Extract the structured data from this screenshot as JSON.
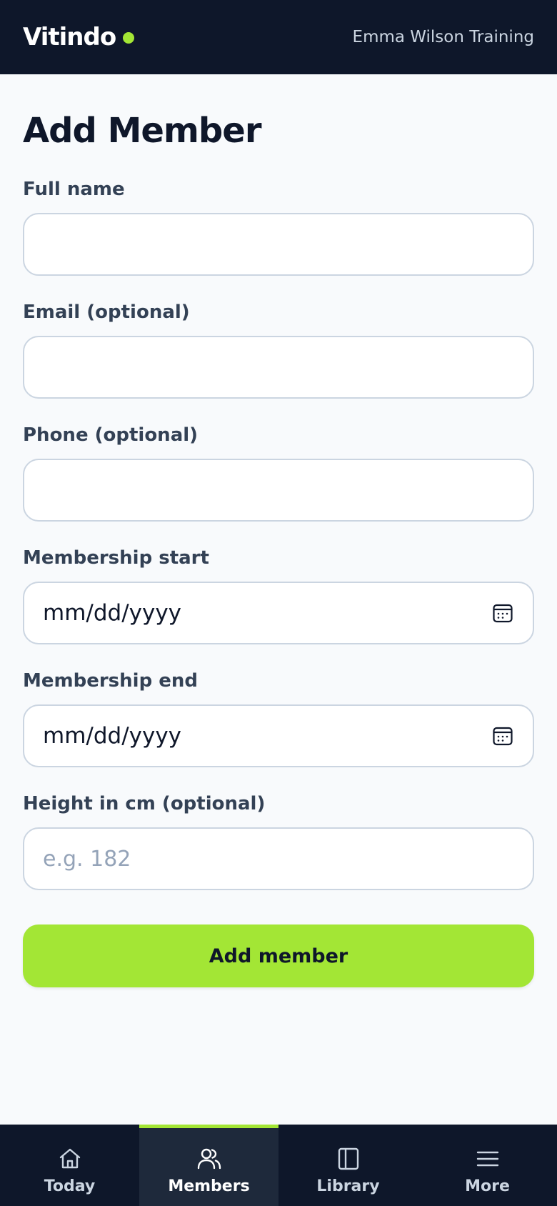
{
  "header": {
    "brand": "Vitindo",
    "org": "Emma Wilson Training",
    "accent_color": "#a3e635",
    "background_color": "#0e172a"
  },
  "main": {
    "title": "Add Member",
    "fields": [
      {
        "label": "Full name",
        "type": "text",
        "value": "",
        "placeholder": ""
      },
      {
        "label": "Email (optional)",
        "type": "email",
        "value": "",
        "placeholder": ""
      },
      {
        "label": "Phone (optional)",
        "type": "tel",
        "value": "",
        "placeholder": ""
      },
      {
        "label": "Membership start",
        "type": "date",
        "display": "mm/dd/yyyy",
        "icon": "calendar-icon"
      },
      {
        "label": "Membership end",
        "type": "date",
        "display": "mm/dd/yyyy",
        "icon": "calendar-icon"
      },
      {
        "label": "Height in cm (optional)",
        "type": "number",
        "value": "",
        "placeholder": "e.g. 182"
      }
    ],
    "submit_label": "Add member"
  },
  "nav": {
    "items": [
      {
        "label": "Today",
        "icon": "home-icon",
        "active": false
      },
      {
        "label": "Members",
        "icon": "users-icon",
        "active": true
      },
      {
        "label": "Library",
        "icon": "panel-icon",
        "active": false
      },
      {
        "label": "More",
        "icon": "menu-icon",
        "active": false
      }
    ]
  }
}
